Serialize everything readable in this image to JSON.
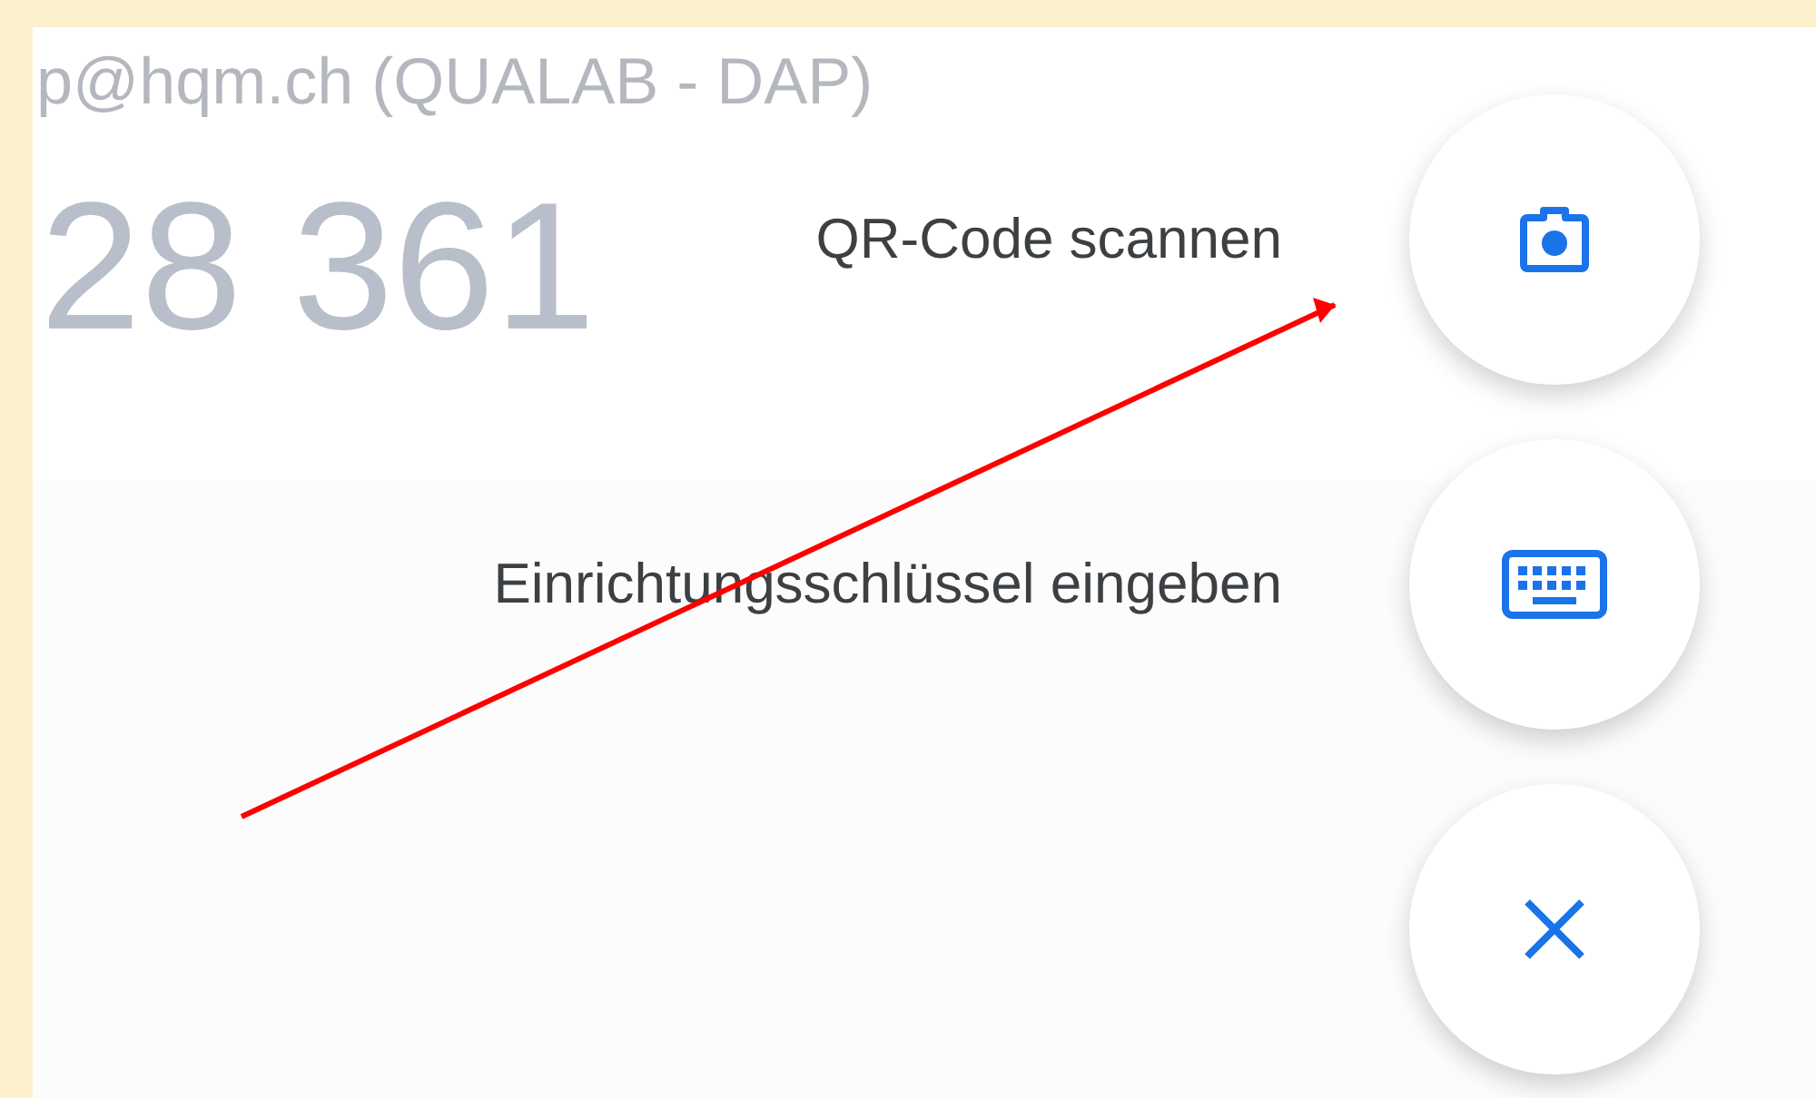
{
  "background": {
    "account": "p@hqm.ch (QUALAB - DAP)",
    "code": "28 361"
  },
  "actions": [
    {
      "label": "QR-Code scannen",
      "kind": "camera"
    },
    {
      "label": "Einrichtungsschlüssel eingeben",
      "kind": "keyboard"
    },
    {
      "kind": "close"
    }
  ]
}
